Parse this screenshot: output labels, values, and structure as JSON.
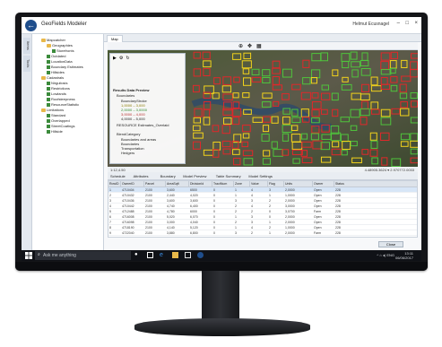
{
  "app": {
    "title": "GeoFields Modeler",
    "user": "Helmut Ecusnagel",
    "win_min": "–",
    "win_max": "□",
    "win_close": "×"
  },
  "leftstrip": {
    "tabs": [
      "Items",
      "Tools"
    ]
  },
  "nav": {
    "items": [
      {
        "label": "Mapcatcher",
        "indent": 1,
        "icon": "folder"
      },
      {
        "label": "Geographies",
        "indent": 2,
        "icon": "folder"
      },
      {
        "label": "Storefronts",
        "indent": 3,
        "icon": "layer"
      },
      {
        "label": "Outdated",
        "indent": 2,
        "icon": "layer"
      },
      {
        "label": "LocationData",
        "indent": 2,
        "icon": "layer"
      },
      {
        "label": "Boundary Estimates",
        "indent": 2,
        "icon": "layer"
      },
      {
        "label": "Hillsides",
        "indent": 2,
        "icon": "layer"
      },
      {
        "label": "Cadastrals",
        "indent": 1,
        "icon": "folder"
      },
      {
        "label": "Nirguliosis",
        "indent": 2,
        "icon": "layer"
      },
      {
        "label": "Restrictions",
        "indent": 2,
        "icon": "layer"
      },
      {
        "label": "Lowlands",
        "indent": 2,
        "icon": "layer"
      },
      {
        "label": "Roofsteepness",
        "indent": 2,
        "icon": "layer"
      },
      {
        "label": "ResourceStatistic",
        "indent": 2,
        "icon": "layer"
      },
      {
        "label": "Limitations",
        "indent": 1,
        "icon": "folder"
      },
      {
        "label": "Standard",
        "indent": 2,
        "icon": "layer"
      },
      {
        "label": "Overlapped",
        "indent": 2,
        "icon": "layer"
      },
      {
        "label": "StreetCoatings",
        "indent": 2,
        "icon": "layer"
      },
      {
        "label": "Hillside",
        "indent": 2,
        "icon": "layer"
      }
    ]
  },
  "work": {
    "tab": "Map",
    "overlay": {
      "title": "Results Data Preview",
      "entries": [
        "Boundaries",
        "BoundaryStroke",
        "1,0000 – 3,000",
        "2,0000 – 3,0000",
        "3,0000 – 4,000",
        "4,0000 – 5,000"
      ],
      "checkbox2": "RESOURCE Estimates_Overlaid",
      "section": "BlendCategory",
      "subs": [
        "Boundaries and areas",
        "Boundaries",
        "Transportation",
        "Hedgers"
      ]
    },
    "status_left": "1:12,4.50",
    "status_right": "4.48905.3624 ▾ 2.970772.0033"
  },
  "gridtabs": [
    "Schedule",
    "Attributes",
    "Boundary",
    "Model Preview",
    "Table Summary",
    "Model Settings"
  ],
  "grid": {
    "headers": [
      "RowID",
      "OwnerID",
      "Parcel",
      "AreaSqft",
      "DivisionId",
      "TractNum",
      "Zone",
      "Value",
      "Flag",
      "Units",
      "Owner",
      "Status"
    ],
    "rows": [
      [
        "1",
        "4710404",
        "2100",
        "3,600",
        "6500",
        "0",
        "1",
        "4",
        "3",
        "2,0000",
        "Open",
        "228"
      ],
      [
        "2",
        "4710432",
        "2100",
        "2,440",
        "4,020",
        "0",
        "1",
        "4",
        "1",
        "1,0000",
        "Open",
        "228"
      ],
      [
        "3",
        "4710436",
        "2100",
        "3,600",
        "3,600",
        "0",
        "3",
        "3",
        "2",
        "2,0000",
        "Open",
        "228"
      ],
      [
        "4",
        "4710442",
        "2100",
        "4,740",
        "6,400",
        "0",
        "2",
        "4",
        "2",
        "3,0000",
        "Open",
        "228"
      ],
      [
        "5",
        "4712488",
        "2100",
        "4,780",
        "6000",
        "0",
        "2",
        "2",
        "0",
        "3,0700",
        "Farm",
        "228"
      ],
      [
        "6",
        "4716008",
        "2100",
        "5,020",
        "6,070",
        "0",
        "1",
        "3",
        "0",
        "2,0000",
        "Open",
        "228"
      ],
      [
        "7",
        "4716098",
        "2100",
        "3,000",
        "4,040",
        "0",
        "2",
        "3",
        "1",
        "2,0000",
        "Open",
        "228"
      ],
      [
        "8",
        "4718190",
        "2100",
        "4,140",
        "5,120",
        "0",
        "1",
        "4",
        "2",
        "1,0000",
        "Open",
        "228"
      ],
      [
        "9",
        "4722040",
        "2100",
        "3,880",
        "6,800",
        "0",
        "3",
        "2",
        "1",
        "2,0000",
        "Farm",
        "228"
      ]
    ]
  },
  "close_label": "Close",
  "taskbar": {
    "search_placeholder": "Ask me anything",
    "tray": "^ ⌂ ◂) ENG",
    "time": "13:11",
    "date": "06/06/2017"
  },
  "colors": {
    "accent": "#1f4e8c",
    "taskbar": "#101217",
    "parcel_red": "#e0282a",
    "parcel_yellow": "#f2d21b",
    "parcel_green": "#4fc43c"
  }
}
